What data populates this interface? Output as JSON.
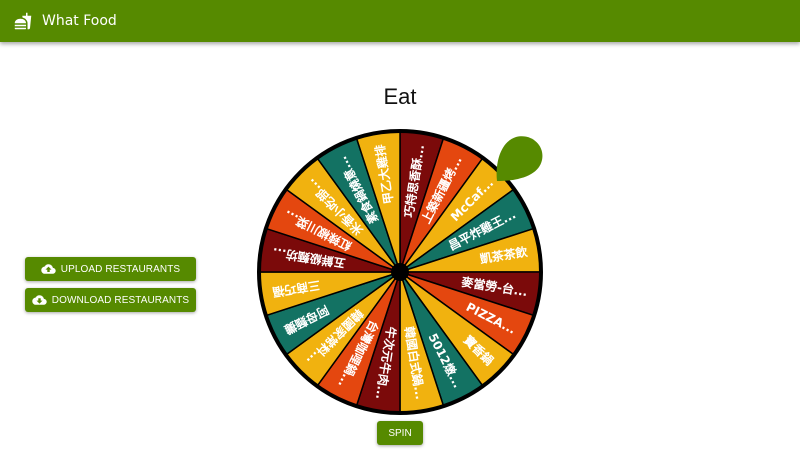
{
  "app": {
    "title": "What Food"
  },
  "page": {
    "title": "Eat"
  },
  "sidebar": {
    "upload_label": "UPLOAD RESTAURANTS",
    "download_label": "DOWNLOAD RESTAURANTS"
  },
  "wheel": {
    "segments": [
      {
        "label": "巧特思香酥...",
        "color": "#7b0a0a"
      },
      {
        "label": "上築新疆烤...",
        "color": "#e4470f"
      },
      {
        "label": "McCaf...",
        "color": "#f1b20f"
      },
      {
        "label": "昌平炸雞王...",
        "color": "#137263"
      },
      {
        "label": "凱茶茶飲",
        "color": "#f1b20f"
      },
      {
        "label": "麥當勞-台...",
        "color": "#7b0a0a"
      },
      {
        "label": "PIZZA...",
        "color": "#e4470f"
      },
      {
        "label": "寶香鍋",
        "color": "#f1b20f"
      },
      {
        "label": "5012燉...",
        "color": "#137263"
      },
      {
        "label": "韓國白式鍋...",
        "color": "#f1b20f"
      },
      {
        "label": "牛次元牛肉...",
        "color": "#7b0a0a"
      },
      {
        "label": "台灣咖哩鍋...",
        "color": "#e4470f"
      },
      {
        "label": "韓國家常料...",
        "color": "#f1b20f"
      },
      {
        "label": "阿母麵攤",
        "color": "#137263"
      },
      {
        "label": "三商巧福",
        "color": "#f1b20f"
      },
      {
        "label": "五鮮級麵坊...",
        "color": "#7b0a0a"
      },
      {
        "label": "紅辣椒川菜...",
        "color": "#e4470f"
      },
      {
        "label": "米香小吃部...",
        "color": "#f1b20f"
      },
      {
        "label": "素食鍋燒意...",
        "color": "#137263"
      },
      {
        "label": "甲乙大雞排",
        "color": "#f1b20f"
      }
    ],
    "pointer_color": "#568a00"
  },
  "spin": {
    "label": "SPIN"
  }
}
